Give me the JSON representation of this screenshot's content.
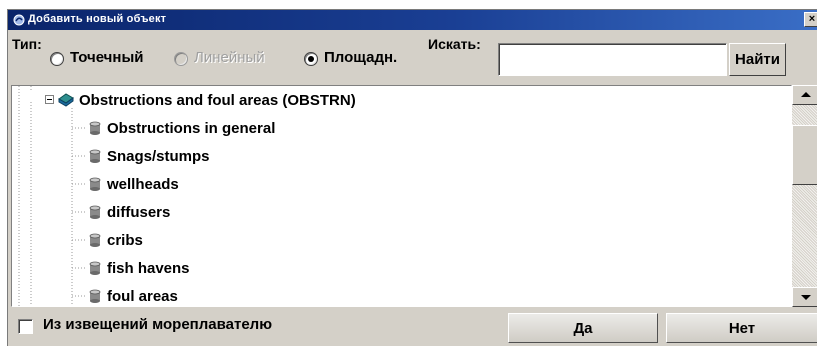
{
  "window": {
    "title": "Добавить новый объект",
    "close_label": "×"
  },
  "toolbar": {
    "type_label": "Тип:",
    "radio_options": [
      {
        "label": "Точечный",
        "selected": false,
        "enabled": true
      },
      {
        "label": "Линейный",
        "selected": false,
        "enabled": false
      },
      {
        "label": "Площадн.",
        "selected": true,
        "enabled": true
      }
    ],
    "search_label": "Искать:",
    "search_value": "",
    "find_button": "Найти"
  },
  "tree": {
    "parent": {
      "label": "Obstructions and foul areas (OBSTRN)",
      "expanded": true,
      "icon": "book-icon"
    },
    "children": [
      {
        "label": "Obstructions in general",
        "icon": "cylinder-icon"
      },
      {
        "label": "Snags/stumps",
        "icon": "cylinder-icon"
      },
      {
        "label": "wellheads",
        "icon": "cylinder-icon"
      },
      {
        "label": "diffusers",
        "icon": "cylinder-icon"
      },
      {
        "label": "cribs",
        "icon": "cylinder-icon"
      },
      {
        "label": "fish havens",
        "icon": "cylinder-icon"
      },
      {
        "label": "foul areas",
        "icon": "cylinder-icon"
      }
    ]
  },
  "footer": {
    "checkbox_label": "Из извещений мореплавателю",
    "checkbox_checked": false,
    "ok_button": "Да",
    "cancel_button": "Нет"
  },
  "colors": {
    "titlebar_start": "#0a246a",
    "titlebar_end": "#3a6ec6",
    "dialog_face": "#d4d0c8"
  }
}
